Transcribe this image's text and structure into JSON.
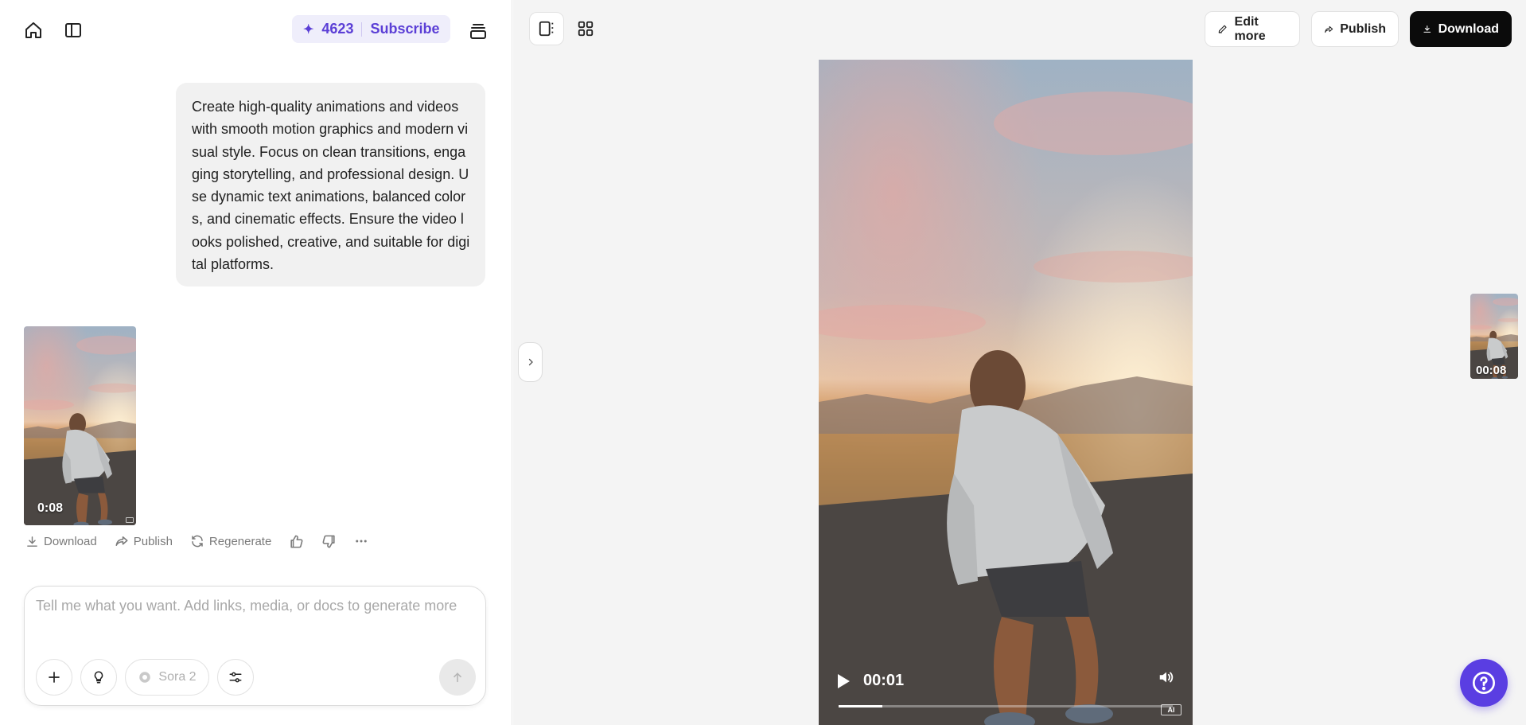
{
  "header": {
    "credits_count": "4623",
    "subscribe_label": "Subscribe"
  },
  "prompt": {
    "text": "Create high-quality animations and videos with smooth motion graphics and modern visual style. Focus on clean transitions, engaging storytelling, and professional design. Use dynamic text animations, balanced colors, and cinematic effects. Ensure the video looks polished, creative, and suitable for digital platforms."
  },
  "result": {
    "duration": "0:08",
    "actions": {
      "download": "Download",
      "publish": "Publish",
      "regenerate": "Regenerate"
    }
  },
  "composer": {
    "placeholder": "Tell me what you want. Add links, media, or docs to generate more",
    "model": "Sora 2"
  },
  "toolbar": {
    "edit_more": "Edit more",
    "publish": "Publish",
    "download": "Download"
  },
  "player": {
    "time": "00:01",
    "progress": 0.13,
    "ai_badge": "AI"
  },
  "side_thumb": {
    "duration": "00:08"
  },
  "colors": {
    "accent": "#5a3ee2",
    "credits_text": "#5b3fd6",
    "credits_bg": "#efeefb"
  }
}
